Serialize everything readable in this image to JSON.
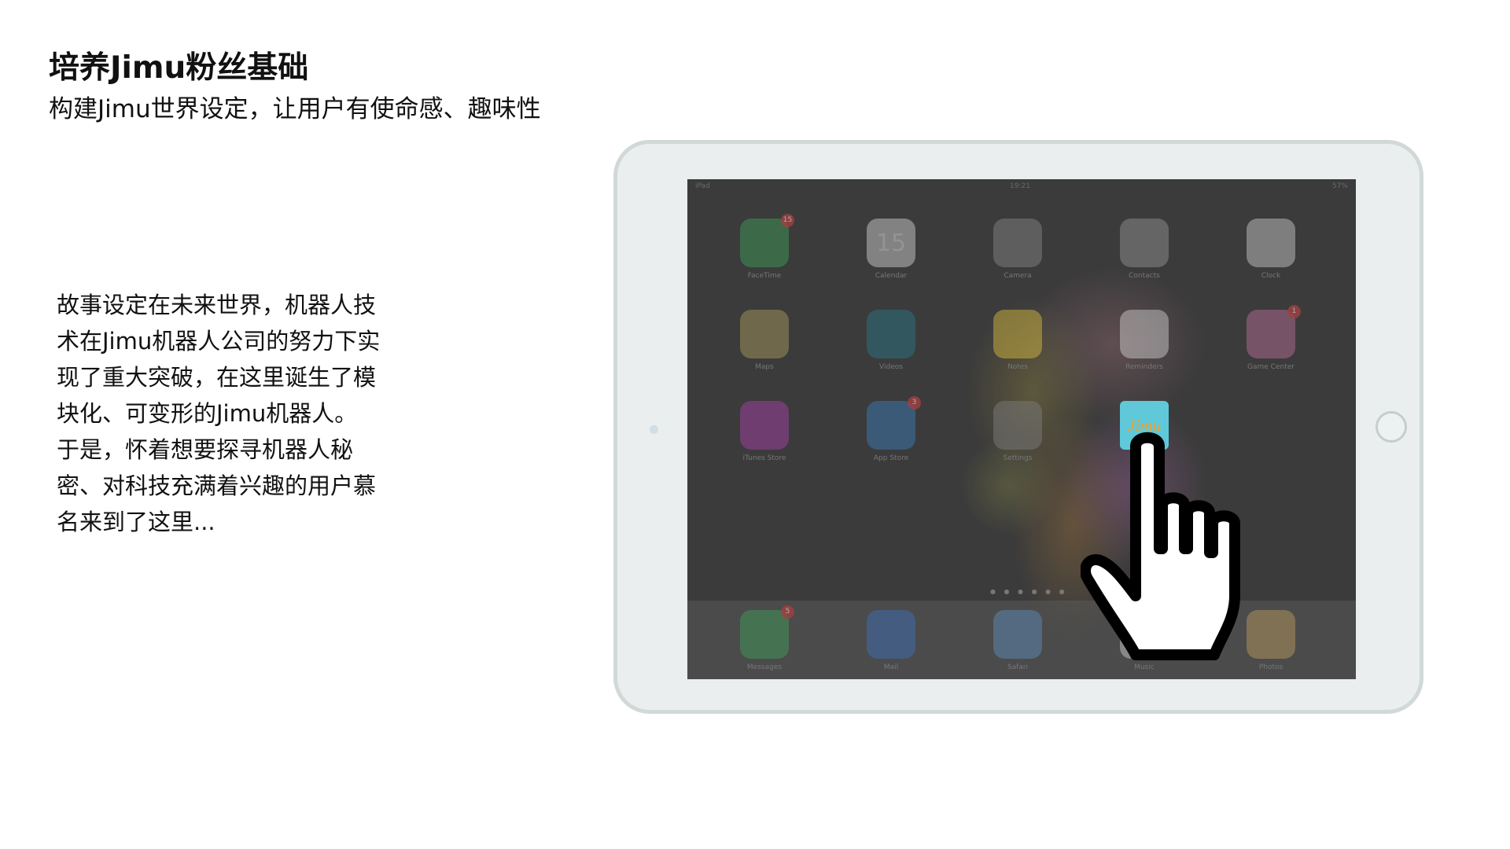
{
  "slide": {
    "title": "培养Jimu粉丝基础",
    "subtitle": "构建Jimu世界设定，让用户有使命感、趣味性",
    "story_lines": [
      "故事设定在未来世界，机器人技",
      "术在Jimu机器人公司的努力下实",
      "现了重大突破，在这里诞生了模",
      "块化、可变形的Jimu机器人。",
      "于是，怀着想要探寻机器人秘",
      "密、对科技充满着兴趣的用户慕",
      "名来到了这里..."
    ]
  },
  "ipad": {
    "status_bar": {
      "carrier": "iPad",
      "time": "19:21",
      "battery": "57%"
    },
    "apps": [
      {
        "label": "FaceTime",
        "icon": "facetime-icon",
        "color": "#3da55a",
        "badge": "15"
      },
      {
        "label": "Calendar",
        "icon": "calendar-icon",
        "color": "#d8d8d8",
        "glyph": "15"
      },
      {
        "label": "Camera",
        "icon": "camera-icon",
        "color": "#8a8a8a"
      },
      {
        "label": "Contacts",
        "icon": "contacts-icon",
        "color": "#9a9a9a"
      },
      {
        "label": "Clock",
        "icon": "clock-icon",
        "color": "#d0d0d0"
      },
      {
        "label": "Maps",
        "icon": "maps-icon",
        "color": "#b0a060"
      },
      {
        "label": "Videos",
        "icon": "videos-icon",
        "color": "#2a7a8a"
      },
      {
        "label": "Notes",
        "icon": "notes-icon",
        "color": "#e0c040"
      },
      {
        "label": "Reminders",
        "icon": "reminders-icon",
        "color": "#d8d8d8"
      },
      {
        "label": "Game Center",
        "icon": "game-center-icon",
        "color": "#c070a0",
        "badge": "1"
      },
      {
        "label": "iTunes Store",
        "icon": "itunes-store-icon",
        "color": "#b040b0"
      },
      {
        "label": "App Store",
        "icon": "app-store-icon",
        "color": "#3a80c0",
        "badge": "3"
      },
      {
        "label": "Settings",
        "icon": "settings-icon",
        "color": "#808080"
      },
      {
        "label": "Jimu",
        "icon": "jimu-app-icon",
        "color": "#5fc9d9",
        "glyph": "Jimu"
      }
    ],
    "dock": [
      {
        "label": "Messages",
        "icon": "messages-icon",
        "color": "#3da55a",
        "badge": "5"
      },
      {
        "label": "Mail",
        "icon": "mail-icon",
        "color": "#3a70c0"
      },
      {
        "label": "Safari",
        "icon": "safari-icon",
        "color": "#6090c0"
      },
      {
        "label": "Music",
        "icon": "music-icon",
        "color": "#d0d0d0"
      },
      {
        "label": "Photos",
        "icon": "photos-icon",
        "color": "#c0a060"
      }
    ]
  }
}
